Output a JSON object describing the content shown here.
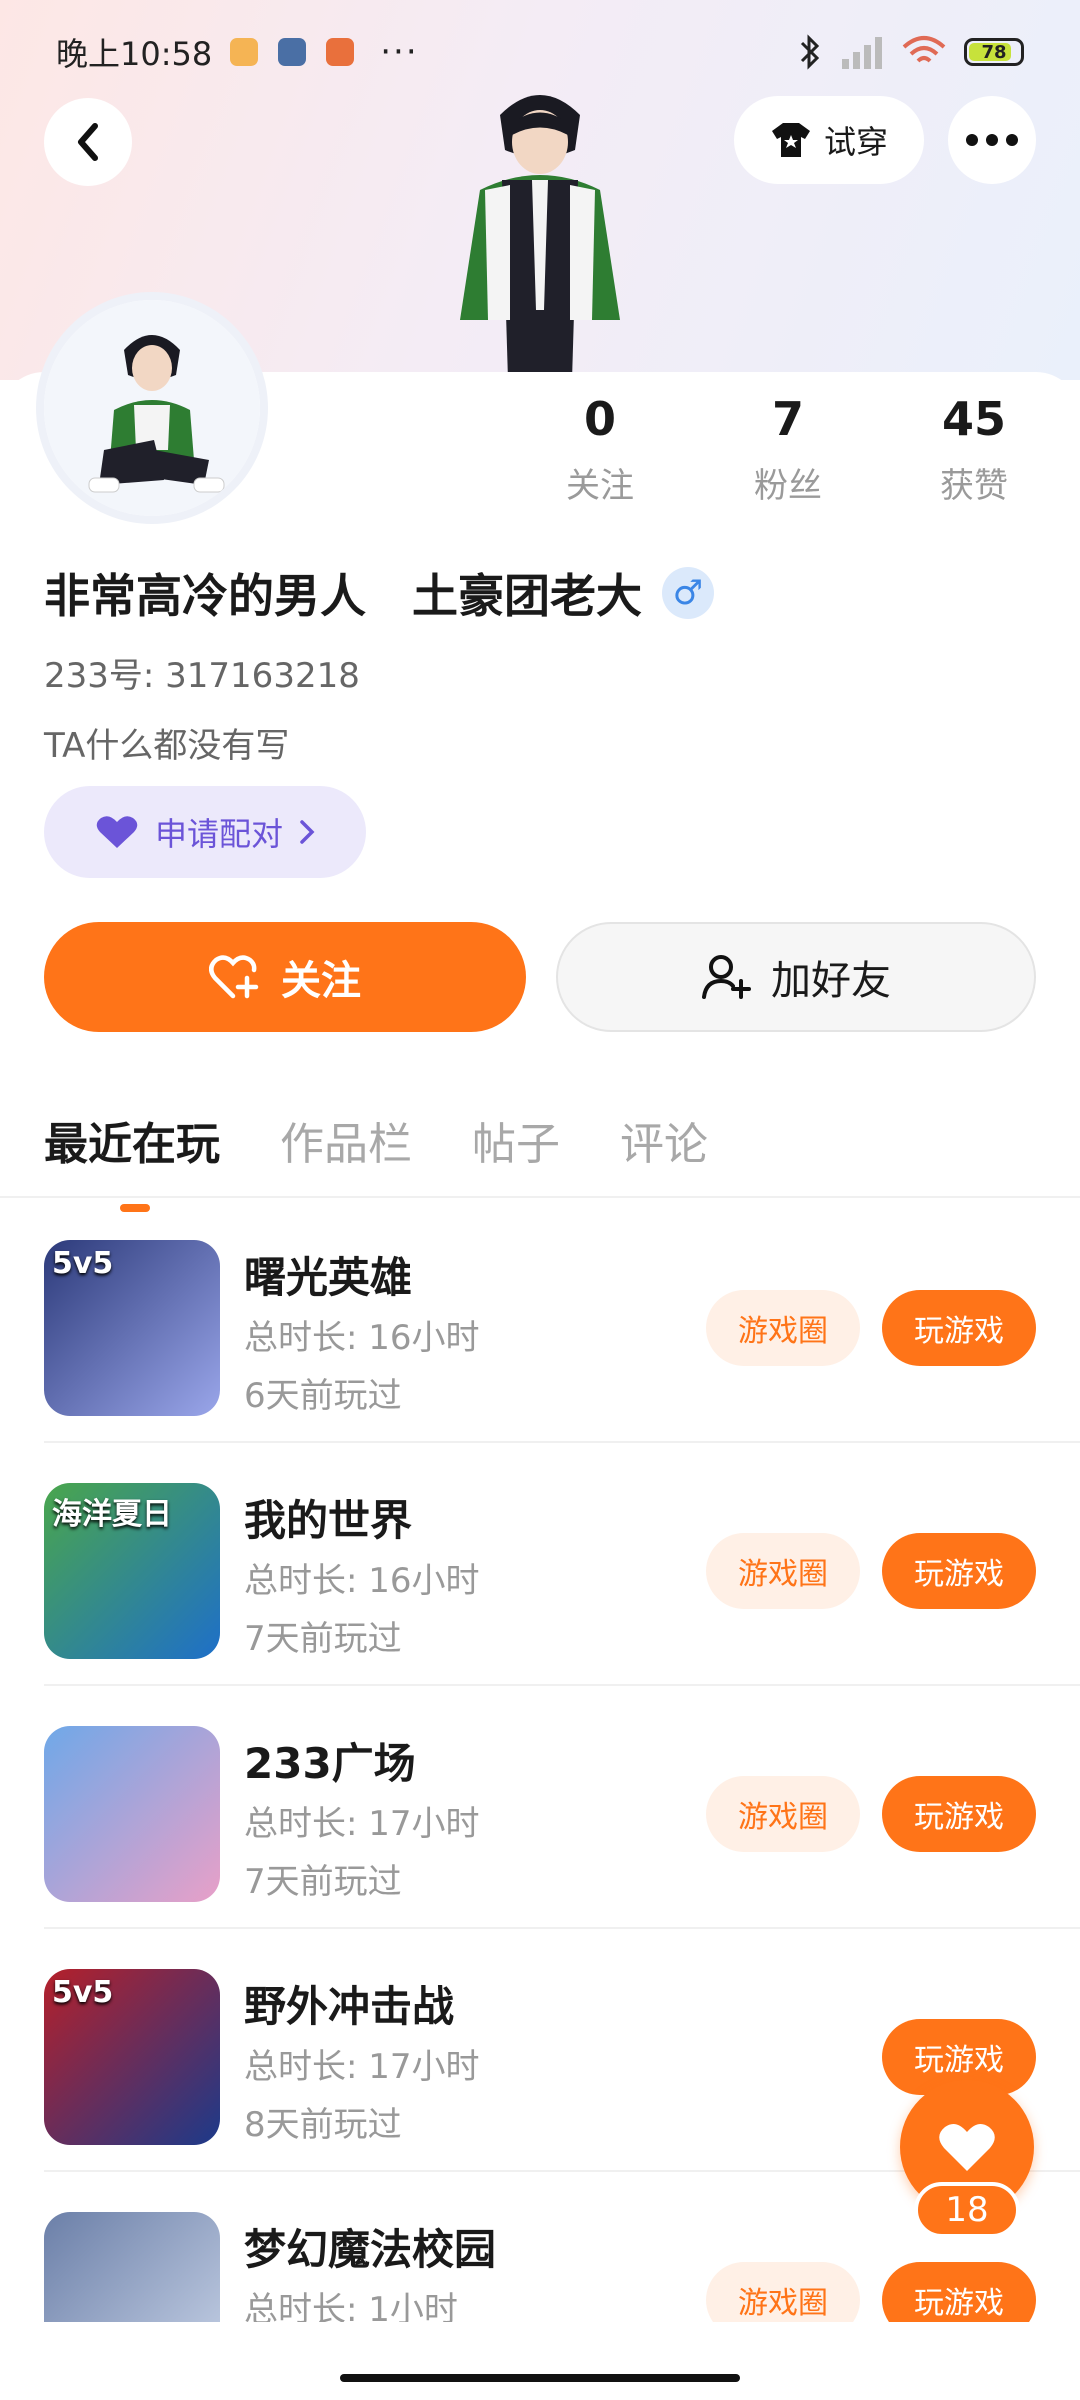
{
  "status_bar": {
    "time": "晚上10:58",
    "dots": "···",
    "battery": "78"
  },
  "header": {
    "tryon_label": "试穿"
  },
  "stats": [
    {
      "value": "0",
      "label": "关注"
    },
    {
      "value": "7",
      "label": "粉丝"
    },
    {
      "value": "45",
      "label": "获赞"
    }
  ],
  "profile": {
    "name": "非常高冷的男人　土豪团老大",
    "gender_symbol": "♂",
    "uid": "233号: 317163218",
    "bio": "TA什么都没有写",
    "match_label": "申请配对"
  },
  "actions": {
    "follow_label": "关注",
    "add_friend_label": "加好友"
  },
  "tabs": [
    "最近在玩",
    "作品栏",
    "帖子",
    "评论"
  ],
  "games": [
    {
      "title": "曙光英雄",
      "duration": "总时长: 16小时",
      "last_played": "6天前玩过",
      "circle_label": "游戏圈",
      "play_label": "玩游戏",
      "icon_text": "5v5",
      "colors": [
        "#2c3a7a",
        "#9aa6ea"
      ]
    },
    {
      "title": "我的世界",
      "duration": "总时长: 16小时",
      "last_played": "7天前玩过",
      "circle_label": "游戏圈",
      "play_label": "玩游戏",
      "icon_text": "海洋夏日",
      "colors": [
        "#4aa64c",
        "#1e6fc9"
      ]
    },
    {
      "title": "233广场",
      "duration": "总时长: 17小时",
      "last_played": "7天前玩过",
      "circle_label": "游戏圈",
      "play_label": "玩游戏",
      "icon_text": "",
      "colors": [
        "#6fa8e8",
        "#e8a0c8"
      ]
    },
    {
      "title": "野外冲击战",
      "duration": "总时长: 17小时",
      "last_played": "8天前玩过",
      "circle_label": "",
      "play_label": "玩游戏",
      "icon_text": "5v5",
      "colors": [
        "#b5202a",
        "#1c3a8a"
      ]
    },
    {
      "title": "梦幻魔法校园",
      "duration": "总时长: 1小时",
      "last_played": "",
      "circle_label": "游戏圈",
      "play_label": "玩游戏",
      "icon_text": "",
      "colors": [
        "#6b7fa8",
        "#c9d4e8"
      ]
    }
  ],
  "fab": {
    "count": "18"
  },
  "colors": {
    "accent": "#ff7418",
    "match_purple": "#6b54d8"
  }
}
